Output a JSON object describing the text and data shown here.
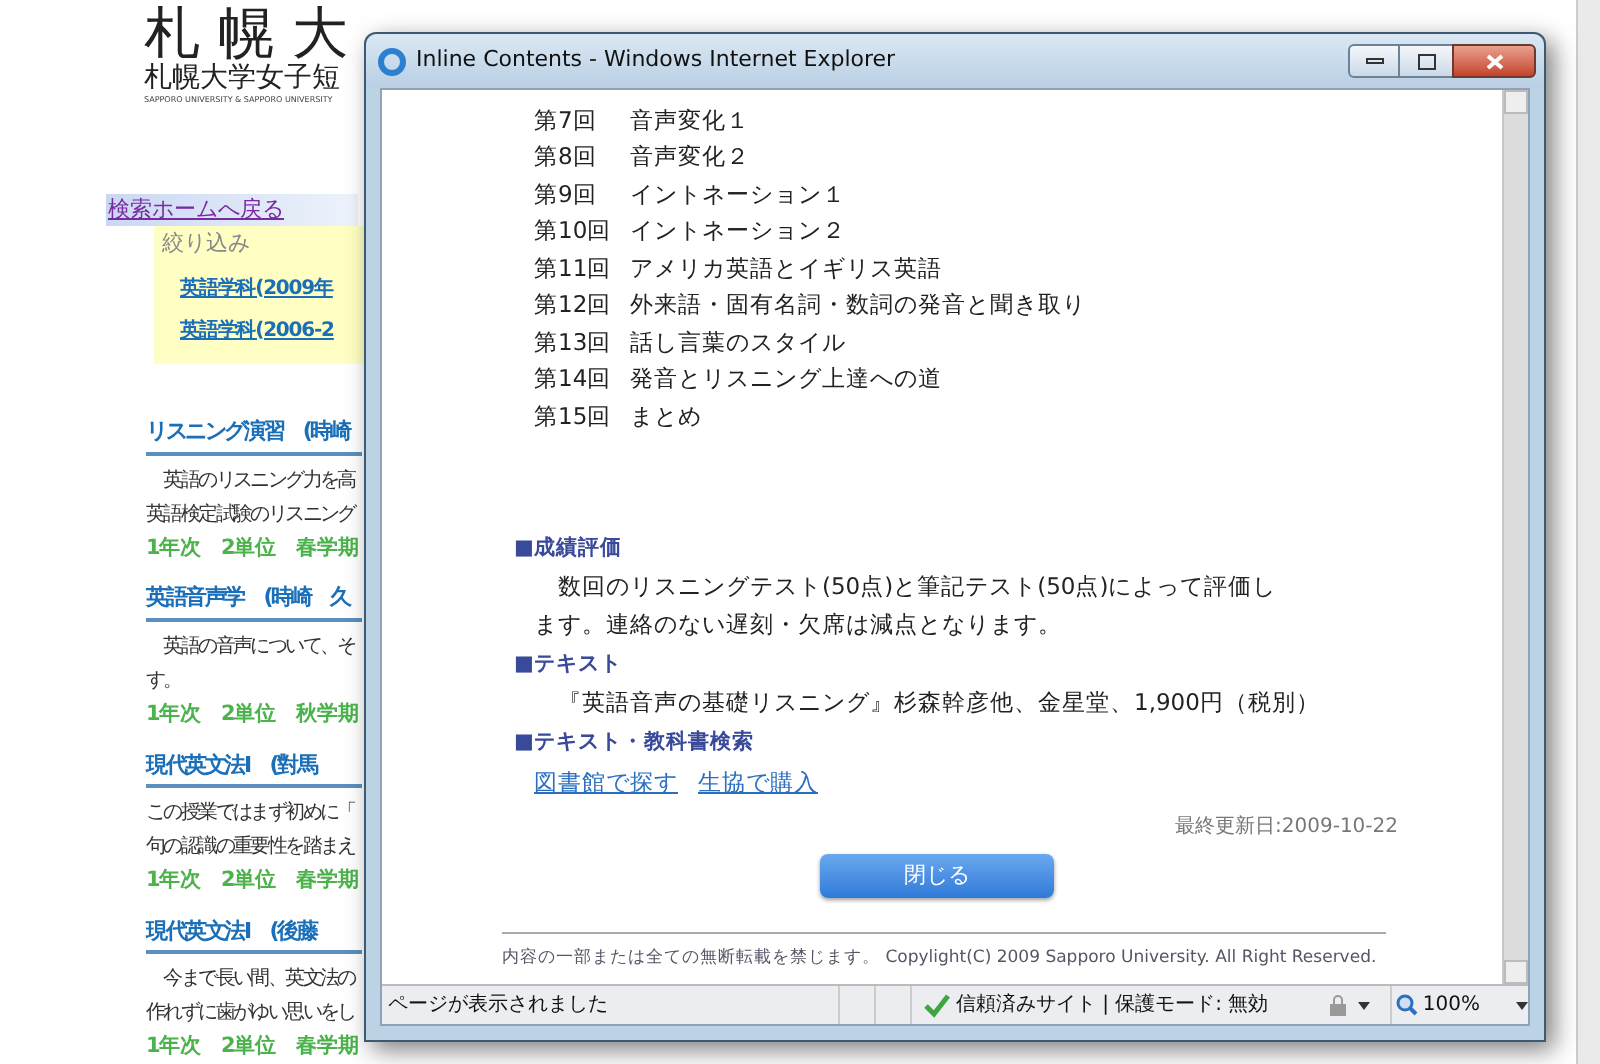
{
  "background_page": {
    "logo_title": "札 幌 大",
    "logo_subtitle": "札幌大学女子短",
    "logo_tagline": "SAPPORO UNIVERSITY & SAPPORO UNIVERSITY",
    "back_link": "検索ホームへ戻る",
    "filter": {
      "label": "絞り込み",
      "items": [
        "英語学科(2009年",
        "英語学科(2006-2"
      ]
    },
    "courses": [
      {
        "title": "リスニング演習　(時崎",
        "lines": [
          "　英語のリスニング力を高",
          "英語検定試験のリスニング"
        ],
        "meta": [
          "1年次",
          "2単位",
          "春学期"
        ]
      },
      {
        "title": "英語音声学　(時崎　久",
        "lines": [
          "　英語の音声について、そ",
          "す。"
        ],
        "meta": [
          "1年次",
          "2単位",
          "秋学期"
        ]
      },
      {
        "title": "現代英文法Ⅰ　(對馬",
        "lines": [
          "この授業ではまず初めに「",
          "句の認識の重要性を踏まえ"
        ],
        "meta": [
          "1年次",
          "2単位",
          "春学期"
        ]
      },
      {
        "title": "現代英文法Ⅰ　(後藤",
        "lines": [
          "　今まで長い間、英文法の",
          "作れずに歯がゆい思いをし"
        ],
        "meta": [
          "1年次",
          "2単位",
          "春学期"
        ]
      }
    ]
  },
  "popup": {
    "title": "Inline Contents - Windows Internet Explorer",
    "schedule": [
      {
        "number": "第7回",
        "topic": "音声変化１"
      },
      {
        "number": "第8回",
        "topic": "音声変化２"
      },
      {
        "number": "第9回",
        "topic": "イントネーション１"
      },
      {
        "number": "第10回",
        "topic": "イントネーション２"
      },
      {
        "number": "第11回",
        "topic": "アメリカ英語とイギリス英語"
      },
      {
        "number": "第12回",
        "topic": "外来語・固有名詞・数詞の発音と聞き取り"
      },
      {
        "number": "第13回",
        "topic": "話し言葉のスタイル"
      },
      {
        "number": "第14回",
        "topic": "発音とリスニング上達への道"
      },
      {
        "number": "第15回",
        "topic": "まとめ"
      }
    ],
    "sections": [
      {
        "heading": "■成績評価",
        "kind": "paragraph",
        "text": "数回のリスニングテスト(50点)と筆記テスト(50点)によって評価します。連絡のない遅刻・欠席は減点となります。"
      },
      {
        "heading": "■テキスト",
        "kind": "text",
        "text": "『英語音声の基礎リスニング』杉森幹彦他、金星堂、1,900円（税別）"
      },
      {
        "heading": "■テキスト・教科書検索",
        "kind": "links",
        "links": [
          "図書館で探す",
          "生協で購入"
        ]
      }
    ],
    "last_updated": "最終更新日:2009-10-22",
    "close_button": "閉じる",
    "copyright": "内容の一部または全ての無断転載を禁じます。 Copylight(C) 2009 Sapporo University. All Right Reserved.",
    "status_bar": {
      "message": "ページが表示されました",
      "zone": "信頼済みサイト | 保護モード: 無効",
      "zoom": "100%"
    }
  }
}
